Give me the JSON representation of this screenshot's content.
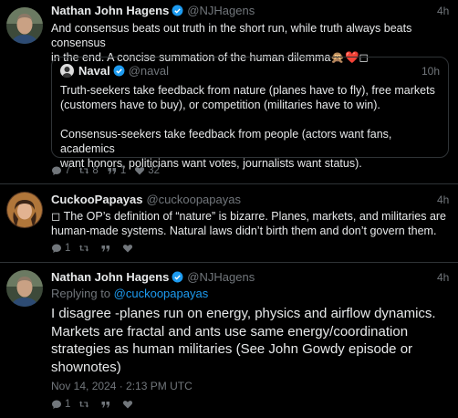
{
  "tweet1": {
    "name": "Nathan John Hagens",
    "handle": "@NJHagens",
    "time": "4h",
    "text_line1": "And consensus beats out truth in the short run, while truth always beats consensus",
    "text_line2": "in the end. A concise summation of the human dilemma🙊❤️◻",
    "quote": {
      "name": "Naval",
      "handle": "@naval",
      "time": "10h",
      "p1_line1": "Truth-seekers take feedback from nature (planes have to fly), free markets",
      "p1_line2": "(customers have to buy), or competition (militaries have to win).",
      "p2_line1": "Consensus-seekers take feedback from people (actors want fans, academics",
      "p2_line2": "want honors, politicians want votes, journalists want status)."
    },
    "actions": {
      "replies": "7",
      "retweets": "8",
      "quotes": "1",
      "likes": "32"
    }
  },
  "tweet2": {
    "name": "CuckooPapayas",
    "handle": "@cuckoopapayas",
    "time": "4h",
    "text_line1": "◻ The OP’s definition of “nature” is bizarre. Planes, markets, and militaries are",
    "text_line2": "human-made systems. Natural laws didn’t birth them and don’t govern them.",
    "actions": {
      "replies": "1"
    }
  },
  "tweet3": {
    "name": "Nathan John Hagens",
    "handle": "@NJHagens",
    "time": "4h",
    "replying_prefix": "Replying to",
    "replying_to": "@cuckoopapayas",
    "line1": "I disagree -planes run on energy, physics and airflow dynamics.",
    "line2": "Markets are fractal and ants use same energy/coordination",
    "line3": "strategies as human militaries (See John Gowdy episode or",
    "line4": "shownotes)",
    "timestamp": "Nov 14, 2024 · 2:13 PM UTC",
    "actions": {
      "replies": "1"
    }
  },
  "colors": {
    "background": "#000000",
    "text": "#e7e9ea",
    "muted": "#71767b",
    "link": "#1d9bf0",
    "border": "#2f3336",
    "verified": "#1d9bf0"
  }
}
